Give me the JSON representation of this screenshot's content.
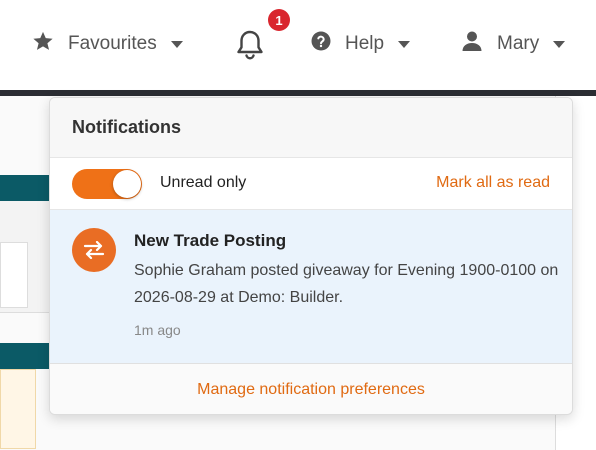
{
  "nav": {
    "favourites_label": "Favourites",
    "help_label": "Help",
    "user_label": "Mary",
    "notification_count": "1"
  },
  "notifications": {
    "title": "Notifications",
    "unread_only_label": "Unread only",
    "unread_only_enabled": true,
    "mark_all_label": "Mark all as read",
    "items": [
      {
        "title": "New Trade Posting",
        "body": "Sophie Graham posted giveaway for Evening 1900-0100 on 2026-08-29 at Demo: Builder.",
        "time": "1m ago",
        "icon": "swap-arrows-icon"
      }
    ],
    "manage_label": "Manage notification preferences"
  },
  "colors": {
    "accent": "#ef7117",
    "badge": "#d9262e",
    "unread_bg": "#eaf3fc",
    "teal": "#0b5a66"
  }
}
